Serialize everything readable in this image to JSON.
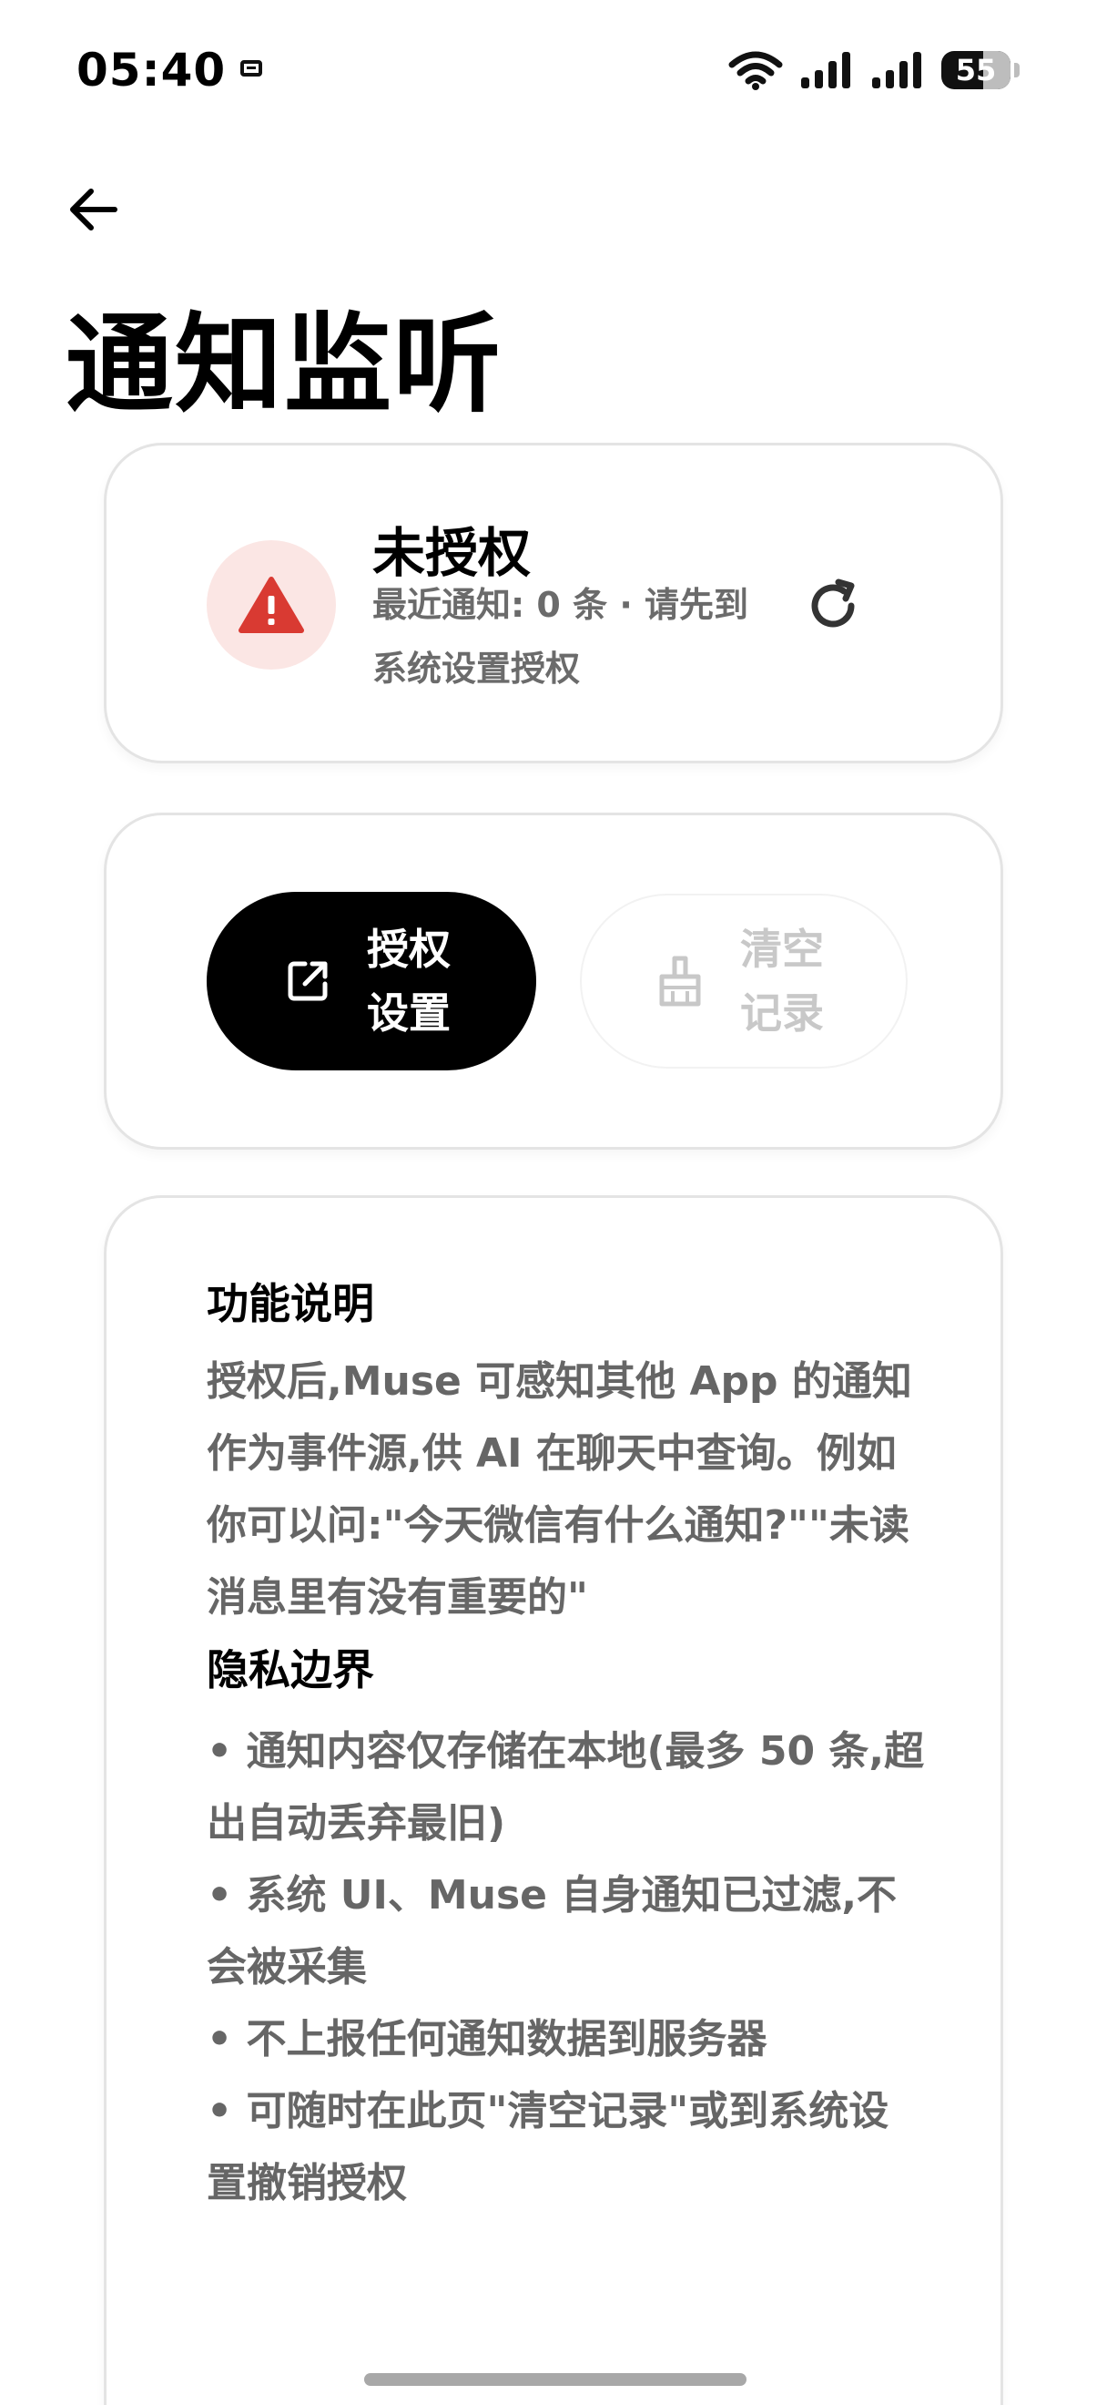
{
  "status_bar": {
    "time": "05:40",
    "battery": "55",
    "icons": [
      "sim-icon",
      "wifi-icon",
      "signal-icon",
      "signal-icon",
      "battery-icon"
    ]
  },
  "header": {
    "back_icon": "arrow-left-icon",
    "title": "通知监听"
  },
  "status_card": {
    "icon": "warning-triangle-icon",
    "title": "未授权",
    "description": "最近通知: 0 条 · 请先到系统设置授权",
    "refresh_icon": "refresh-icon"
  },
  "actions": {
    "auth_settings_label": "授权设置",
    "auth_settings_icon": "external-link-icon",
    "clear_records_label": "清空记录",
    "clear_records_icon": "broom-icon",
    "clear_records_enabled": false
  },
  "info": {
    "feature_heading": "功能说明",
    "feature_text": "授权后,Muse 可感知其他 App 的通知作为事件源,供 AI 在聊天中查询。例如你可以问:\"今天微信有什么通知?\"\"未读消息里有没有重要的\"",
    "privacy_heading": "隐私边界",
    "privacy_items": [
      "• 通知内容仅存储在本地(最多 50 条,超出自动丢弃最旧)",
      "• 系统 UI、Muse 自身通知已过滤,不会被采集",
      "• 不上报任何通知数据到服务器",
      "• 可随时在此页\"清空记录\"或到系统设置撤销授权"
    ]
  },
  "colors": {
    "primary": "#000000",
    "warning": "#d93a32",
    "warning_bg": "#fbe6e4",
    "muted_text": "#666666",
    "disabled": "#c8c8c8"
  }
}
